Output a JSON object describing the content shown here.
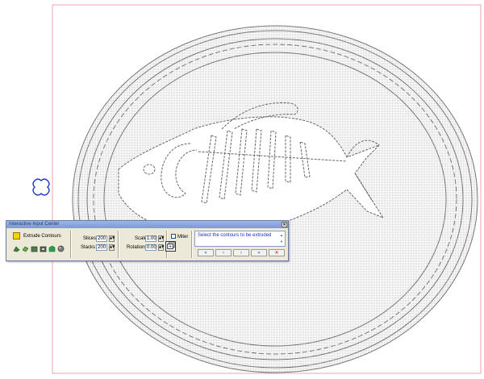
{
  "window": {
    "title": "Interactive Input Center",
    "close_glyph": "×"
  },
  "extrude": {
    "mode_label": "Extrude Contours",
    "mode_color": "#f2d300",
    "tools": [
      "extrude-solid-icon",
      "extrude-surface-icon",
      "extrude-block-icon",
      "extrude-box-icon",
      "extrude-green-icon",
      "extrude-sphere-icon"
    ]
  },
  "slices_stacks": {
    "slices_label": "Slices",
    "slices_value": "200",
    "stacks_label": "Stacks",
    "stacks_value": "200",
    "spin_glyph": "▲▼"
  },
  "transform": {
    "scale_label": "Scale",
    "scale_value": "1.00",
    "rotations_label": "Rotations",
    "rotations_value": "0.00"
  },
  "miter": {
    "label": "Miter",
    "checked": false
  },
  "prompt": {
    "text": "Select the contours to be extruded",
    "scroll_up": "▲",
    "scroll_down": "▼"
  },
  "navigation": {
    "first": "«",
    "prev": "‹",
    "next": "›",
    "last": "»",
    "cancel": "✕"
  },
  "colors": {
    "drawing_border": "#f2a0b0",
    "line": "#7a7a7a",
    "hatch": "#d9d9d9",
    "title_bar": "#8aa4de",
    "prompt_text": "#1a31c8",
    "cursor_marker": "#1a2fd0"
  }
}
